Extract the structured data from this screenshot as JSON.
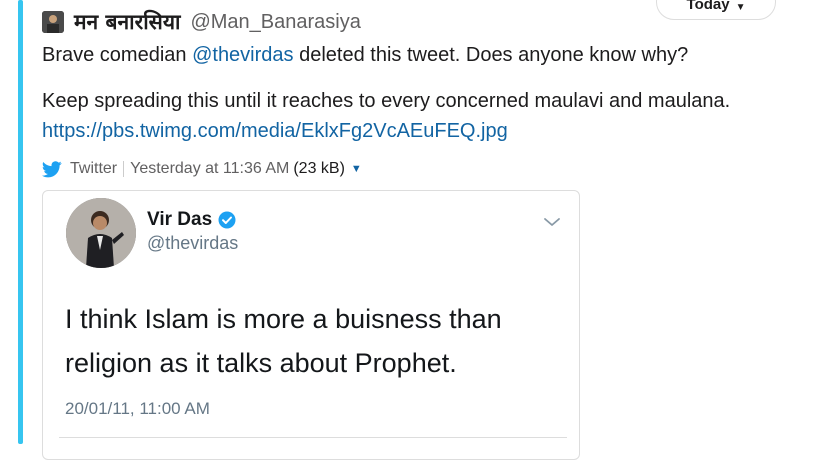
{
  "day_divider": {
    "label": "Today"
  },
  "message": {
    "author_name": "मन बनारसिया",
    "author_handle": "@Man_Banarasiya",
    "line1_before": "Brave comedian ",
    "line1_mention": "@thevirdas",
    "line1_after": " deleted this tweet. Does anyone know why?",
    "line2": "Keep spreading this until it reaches to every concerned maulavi and maulana.",
    "link": "https://pbs.twimg.com/media/EklxFg2VcAEuFEQ.jpg"
  },
  "attachment_meta": {
    "icon": "twitter-bird-icon",
    "source": "Twitter",
    "timestamp": "Yesterday at 11:36 AM",
    "size": "(23 kB)"
  },
  "tweet": {
    "name": "Vir Das",
    "handle": "@thevirdas",
    "verified": true,
    "text_line1": "I think Islam is more a buisness than",
    "text_line2": "religion as it talks about Prophet.",
    "date": "20/01/11, 11:00 AM"
  },
  "colors": {
    "accent_bar": "#36c5f0",
    "link": "#1264a3",
    "twitter_blue": "#1da1f2"
  }
}
